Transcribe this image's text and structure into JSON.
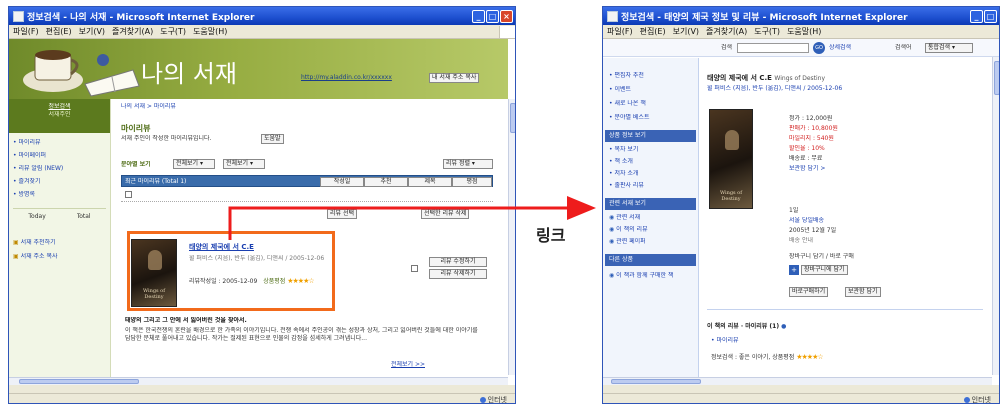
{
  "left_window": {
    "title": "정보검색 - 나의 서재 - Microsoft Internet Explorer",
    "menu": [
      "파일(F)",
      "편집(E)",
      "보기(V)",
      "즐겨찾기(A)",
      "도구(T)",
      "도움말(H)"
    ],
    "banner_title": "나의 서재",
    "banner_url": "http://my.aladdin.co.kr/xxxxxx",
    "banner_url_button": "내 서재 주소 복사",
    "profile_name": "정보검색",
    "profile_sub": "서재주인",
    "left_nav": [
      "• 마이리뷰",
      "• 마이페이퍼",
      "• 리뷰 알림 (NEW)",
      "• 즐겨찾기",
      "• 방명록"
    ],
    "left_nav_tabs": [
      "Today",
      "Total"
    ],
    "left_nav_links": [
      "서재 추천하기",
      "서재 주소 복사"
    ],
    "breadcrumb": "나의 서재 > 마이리뷰",
    "section_title": "마이리뷰",
    "section_desc": "서재 주인이 작성한 마이리뷰입니다.",
    "section_desc_button": "도움말",
    "filter_label": "분야별 보기",
    "filter_select1": "전체보기",
    "filter_select2": "전체보기",
    "filter_right": "리뷰 정렬",
    "table_header": "최근 마이리뷰 (Total 1)",
    "table_tabs": [
      "작성일",
      "추천",
      "제목",
      "평점"
    ],
    "action_buttons": [
      "리뷰 선택",
      "선택한 리뷰 삭제"
    ],
    "review_book_title": "태양의 제국에 서 C.E",
    "review_book_meta": "윌 퍼비스 (지음), 반두 (옮김), 디앤씨 / 2005-12-06",
    "review_date_label": "리뷰작성일 : 2005-12-09",
    "review_rating_label": "상품평점",
    "review_stars": "★★★★☆",
    "review_side_buttons": [
      "리뷰 수정하기",
      "리뷰 삭제하기"
    ],
    "review_headline": "태양의 그리고 그 안에 서 잃어버린 것을 찾아서.",
    "review_body": "이 책은 한국전쟁의 혼란을 배경으로 한 가족의 이야기입니다. 전쟁 속에서 주인공이 겪는 성장과 상처, 그리고 잃어버린 것들에 대한 이야기를 담담한 문체로 풀어내고 있습니다. 작가는 절제된 표현으로 인물의 감정을 섬세하게 그려냅니다...",
    "review_more": "전체보기 >>",
    "status_zone": "인터넷"
  },
  "arrow_label": "링크",
  "right_window": {
    "title": "정보검색 - 태양의 제국 정보 및 리뷰 - Microsoft Internet Explorer",
    "menu": [
      "파일(F)",
      "편집(E)",
      "보기(V)",
      "즐겨찾기(A)",
      "도구(T)",
      "도움말(H)"
    ],
    "search_label": "검색",
    "search_go": "GO",
    "search_detail": "상세검색",
    "search_right_label": "검색어",
    "search_right_select": "통합검색",
    "left_nav": [
      "• 편집자 추천",
      "• 이벤트",
      "• 새로 나온 책",
      "• 분야별 베스트"
    ],
    "left_box1_title": "상품 정보 보기",
    "left_box1_items": [
      "• 목차 보기",
      "• 책 소개",
      "• 저자 소개",
      "• 출판사 리뷰"
    ],
    "left_box2_title": "관련 서재 보기",
    "left_box2_items": [
      "관련 서재",
      "이 책의 리뷰",
      "관련 페이퍼"
    ],
    "left_box3_title": "다른 상품",
    "left_box3_items": [
      "이 책과 함께 구매한 책"
    ],
    "book_title": "태양의 제국에 서 C.E",
    "book_title_en": "Wings of Destiny",
    "book_authors": "윌 퍼비스 (지음), 반두 (옮김), 디앤씨 / 2005-12-06",
    "price_lines": [
      "정가 : 12,000원",
      "판매가 : 10,800원",
      "마일리지 : 540원",
      "할인율 : 10%",
      "배송료 : 무료"
    ],
    "price_link": "보관함 담기 >",
    "stock_lines": [
      "1일",
      "서울 당일배송",
      "2005년 12월 7일"
    ],
    "stock_small": "배송 안내",
    "cart_note": "장바구니 담기 / 바로 구매",
    "cart_button": "장바구니에 담기",
    "small_buttons": [
      "바로구매하기",
      "보관함 담기"
    ],
    "review_section_title": "이 책의 리뷰 · 마이리뷰 (1)",
    "review_link": "• 마이리뷰",
    "review_line": "정보검색 : 좋은 이야기, 상품평점",
    "review_stars": "★★★★☆",
    "status_zone": "인터넷"
  }
}
